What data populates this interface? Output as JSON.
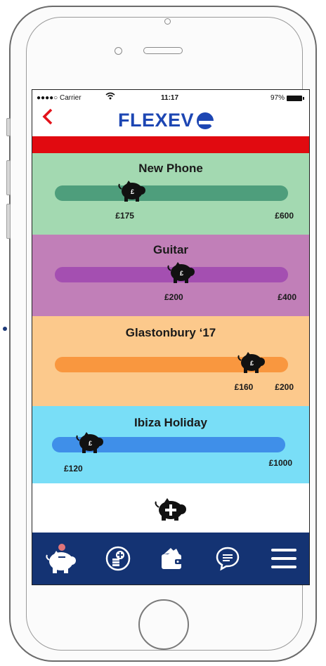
{
  "status_bar": {
    "carrier": "●●●●○ Carrier",
    "time": "11:17",
    "battery": "97%"
  },
  "header": {
    "back_icon": "chevron-left-icon",
    "logo_text": "FLEXEV"
  },
  "goals": [
    {
      "name": "New Phone",
      "saved": "£175",
      "target": "£600",
      "progress": 0.29,
      "bg": "#a3d9b1",
      "track": "#4e9e7c"
    },
    {
      "name": "Guitar",
      "saved": "£200",
      "target": "£400",
      "progress": 0.5,
      "bg": "#c17fb8",
      "track": "#a44fb1"
    },
    {
      "name": "Glastonbury ‘17",
      "saved": "£160",
      "target": "£200",
      "progress": 0.8,
      "bg": "#fcc98c",
      "track": "#f9973f"
    },
    {
      "name": "Ibiza Holiday",
      "saved": "£120",
      "target": "£1000",
      "progress": 0.12,
      "bg": "#79def7",
      "track": "#3f8fe9"
    }
  ],
  "add_goal": {
    "icon": "piggy-bank-add-icon"
  },
  "nav": [
    {
      "icon": "piggy-bank-icon",
      "active": true
    },
    {
      "icon": "add-coins-icon",
      "active": false
    },
    {
      "icon": "wallet-icon",
      "active": false
    },
    {
      "icon": "chat-icon",
      "active": false
    },
    {
      "icon": "menu-icon",
      "active": false
    }
  ]
}
